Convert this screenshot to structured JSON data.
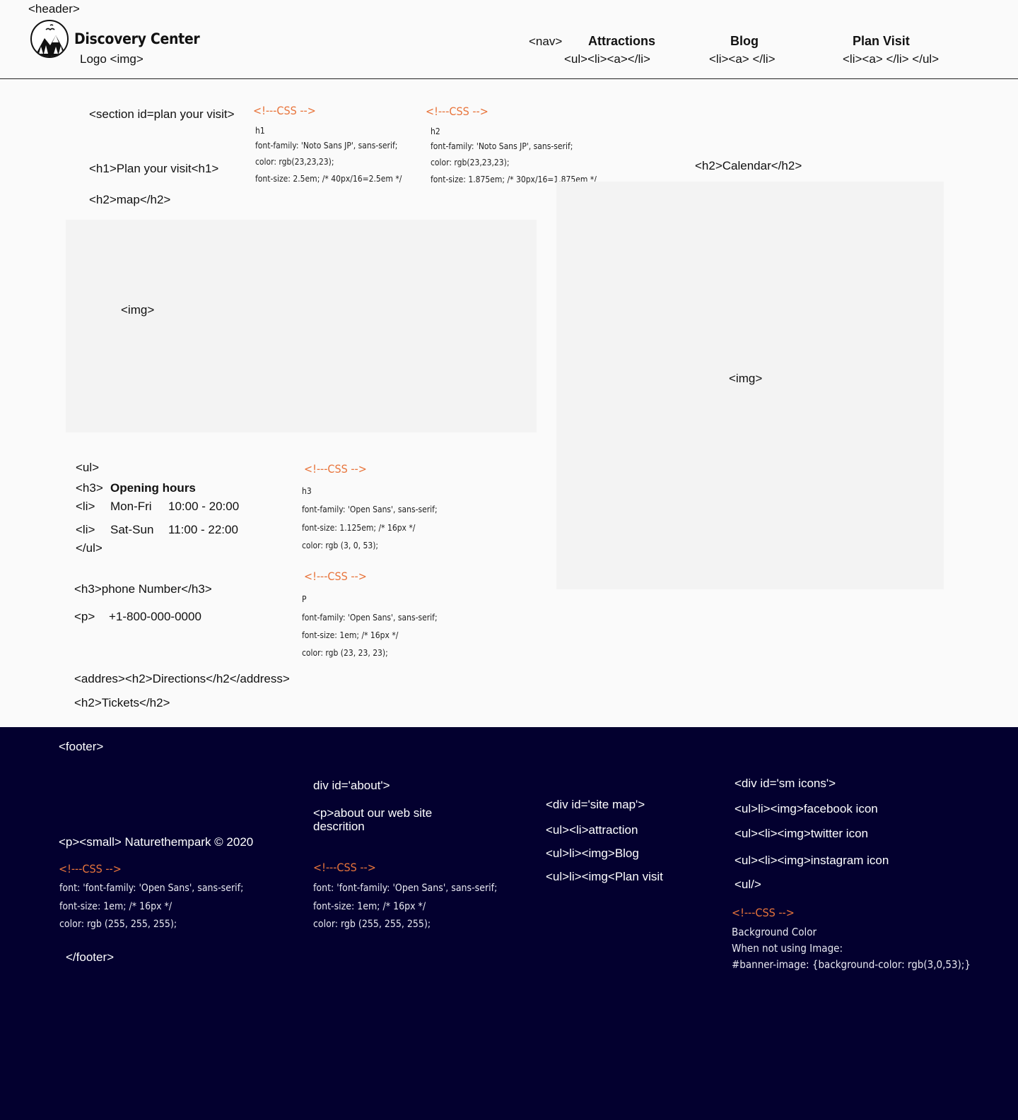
{
  "header": {
    "tag": "<header>",
    "brand": "Discovery Center",
    "logo_label": "Logo <img>",
    "nav_tag": "<nav>",
    "nav": [
      {
        "label": "Attractions",
        "sub": "<ul><li><a></li>"
      },
      {
        "label": "Blog",
        "sub": "<li><a> </li>"
      },
      {
        "label": "Plan Visit",
        "sub": "<li><a> </li> </ul>"
      }
    ]
  },
  "section": {
    "tag": "<section id=plan your visit>",
    "h1": "<h1>Plan your visit<h1>",
    "h2_map": "<h2>map</h2>",
    "map_img": "<img>",
    "h2_calendar": "<h2>Calendar</h2>",
    "calendar_img": "<img>",
    "css_h1": {
      "comment": "<!---CSS -->",
      "selector": "h1",
      "lines": [
        "font-family: 'Noto Sans JP', sans-serif;",
        "color: rgb(23,23,23);",
        "font-size: 2.5em; /* 40px/16=2.5em */"
      ]
    },
    "css_h2": {
      "comment": "<!---CSS -->",
      "selector": "h2",
      "lines": [
        "font-family: 'Noto Sans JP', sans-serif;",
        "color: rgb(23,23,23);",
        "font-size: 1.875em; /* 30px/16=1.875em */"
      ]
    },
    "hours": {
      "ul_open": "<ul>",
      "h3_tag": "<h3>",
      "h3_text": "Opening hours",
      "rows": [
        {
          "tag": "<li>",
          "days": "Mon-Fri",
          "time": "10:00 - 20:00"
        },
        {
          "tag": "<li>",
          "days": "Sat-Sun",
          "time": "11:00 - 22:00"
        }
      ],
      "ul_close": "</ul>"
    },
    "css_h3": {
      "comment": "<!---CSS -->",
      "selector": "h3",
      "lines": [
        "font-family: 'Open Sans', sans-serif;",
        "font-size: 1.125em; /* 16px */",
        "color: rgb (3, 0, 53);"
      ]
    },
    "phone_h3": "<h3>phone Number</h3>",
    "phone_tag": "<p>",
    "phone_number": "+1-800-000-0000",
    "css_p": {
      "comment": "<!---CSS -->",
      "selector": "P",
      "lines": [
        "font-family: 'Open Sans', sans-serif;",
        "font-size: 1em; /* 16px */",
        "color: rgb (23, 23, 23);"
      ]
    },
    "directions": "<addres><h2>Directions</h2</address>",
    "tickets": "<h2>Tickets</h2>"
  },
  "footer": {
    "open": "<footer>",
    "copyright": "<p><small> Naturethempark © 2020",
    "css_left": {
      "comment": "<!---CSS -->",
      "lines": [
        "font: 'font-family: 'Open Sans', sans-serif;",
        "font-size: 1em; /* 16px */",
        "color: rgb (255, 255, 255);"
      ]
    },
    "close": "</footer>",
    "about_div": "div id='about'>",
    "about_p": "<p>about our web site",
    "about_p2": "descrition",
    "css_mid": {
      "comment": "<!---CSS -->",
      "lines": [
        "font: 'font-family: 'Open Sans', sans-serif;",
        "font-size: 1em; /* 16px */",
        "color: rgb (255, 255, 255);"
      ]
    },
    "sitemap_div": "<div id='site map'>",
    "sitemap_items": [
      "<ul><li>attraction",
      "<ul>li><img>Blog",
      "<ul>li><img<Plan visit"
    ],
    "sm_div": "<div id='sm icons'>",
    "sm_items": [
      "<ul>li><img>facebook icon",
      "<ul><li><img>twitter icon",
      "<ul><li><img>instagram icon",
      "<ul/>"
    ],
    "css_right": {
      "comment": "<!---CSS -->",
      "lines": [
        "Background Color",
        "When not using Image:",
        "#banner-image: {background-color: rgb(3,0,53);}"
      ]
    }
  },
  "colors": {
    "footer_bg": "#03002f",
    "comment": "#e8743b",
    "page_bg": "#fafafa"
  }
}
